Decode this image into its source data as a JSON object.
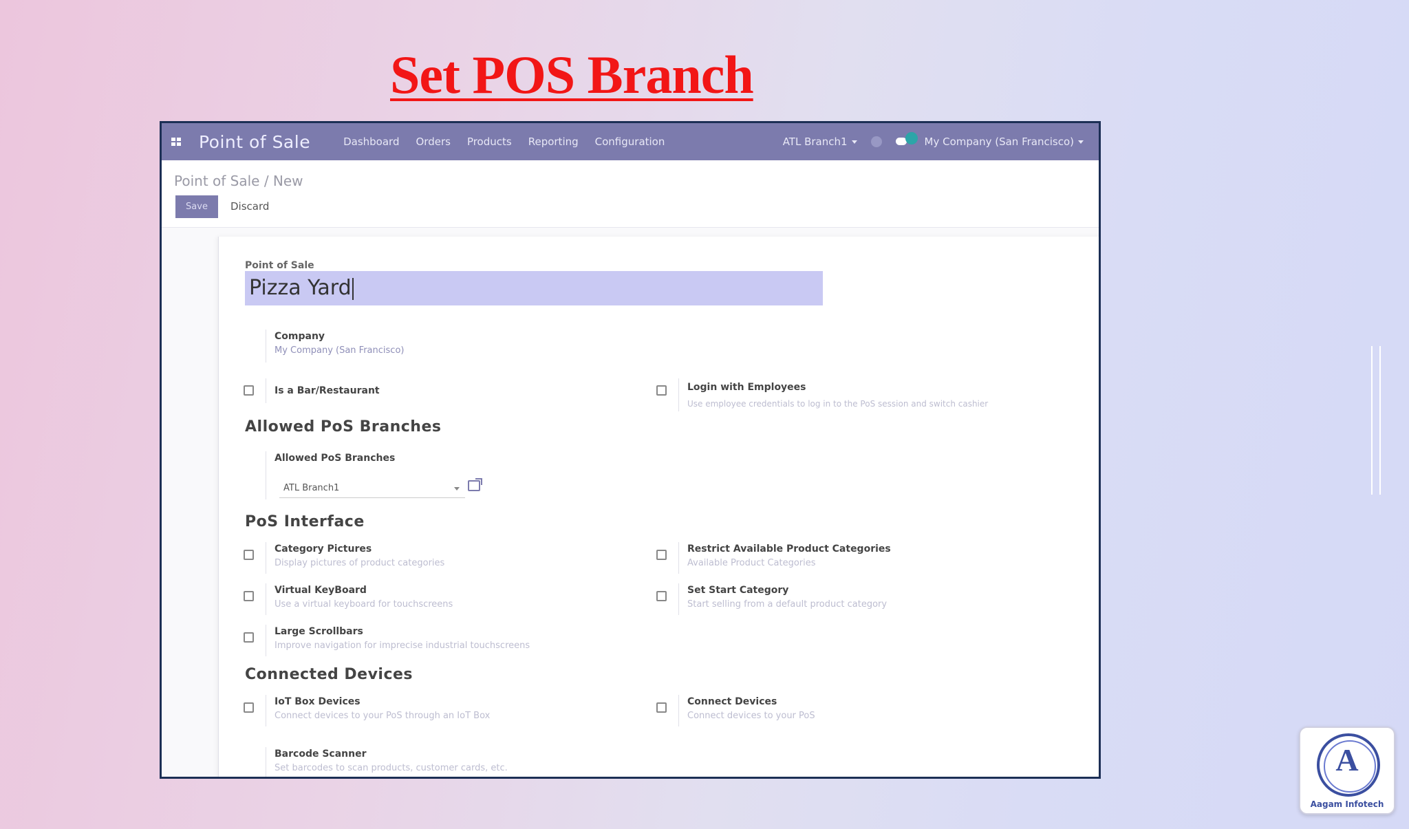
{
  "slide": {
    "title": "Set POS Branch",
    "logo_text": "Aagam Infotech"
  },
  "navbar": {
    "brand": "Point of Sale",
    "menu": [
      "Dashboard",
      "Orders",
      "Products",
      "Reporting",
      "Configuration"
    ],
    "branch_selector": "ATL Branch1",
    "company_selector": "My Company (San Francisco)"
  },
  "control": {
    "breadcrumb": "Point of Sale / New",
    "save_label": "Save",
    "discard_label": "Discard"
  },
  "form": {
    "name_label": "Point of Sale",
    "name_value": "Pizza Yard",
    "company_label": "Company",
    "company_value": "My Company (San Francisco)",
    "bar_restaurant_label": "Is a Bar/Restaurant",
    "login_employees_label": "Login with Employees",
    "login_employees_help": "Use employee credentials to log in to the PoS session and switch cashier",
    "allowed_branches_section": "Allowed PoS Branches",
    "allowed_branches_label": "Allowed PoS Branches",
    "allowed_branches_value": "ATL Branch1",
    "pos_interface_section": "PoS Interface",
    "category_pictures_label": "Category Pictures",
    "category_pictures_help": "Display pictures of product categories",
    "restrict_categories_label": "Restrict Available Product Categories",
    "restrict_categories_help": "Available Product Categories",
    "virtual_keyboard_label": "Virtual KeyBoard",
    "virtual_keyboard_help": "Use a virtual keyboard for touchscreens",
    "start_category_label": "Set Start Category",
    "start_category_help": "Start selling from a default product category",
    "large_scrollbars_label": "Large Scrollbars",
    "large_scrollbars_help": "Improve navigation for imprecise industrial touchscreens",
    "connected_devices_section": "Connected Devices",
    "iot_box_label": "IoT Box Devices",
    "iot_box_help": "Connect devices to your PoS through an IoT Box",
    "connect_devices_label": "Connect Devices",
    "connect_devices_help": "Connect devices to your PoS",
    "barcode_label": "Barcode Scanner",
    "barcode_help": "Set barcodes to scan products, customer cards, etc."
  },
  "colors": {
    "navbar": "#7c7bad",
    "title_red": "#f21616",
    "input_highlight": "#c9c9f3",
    "frame_border": "#1c2f55"
  }
}
